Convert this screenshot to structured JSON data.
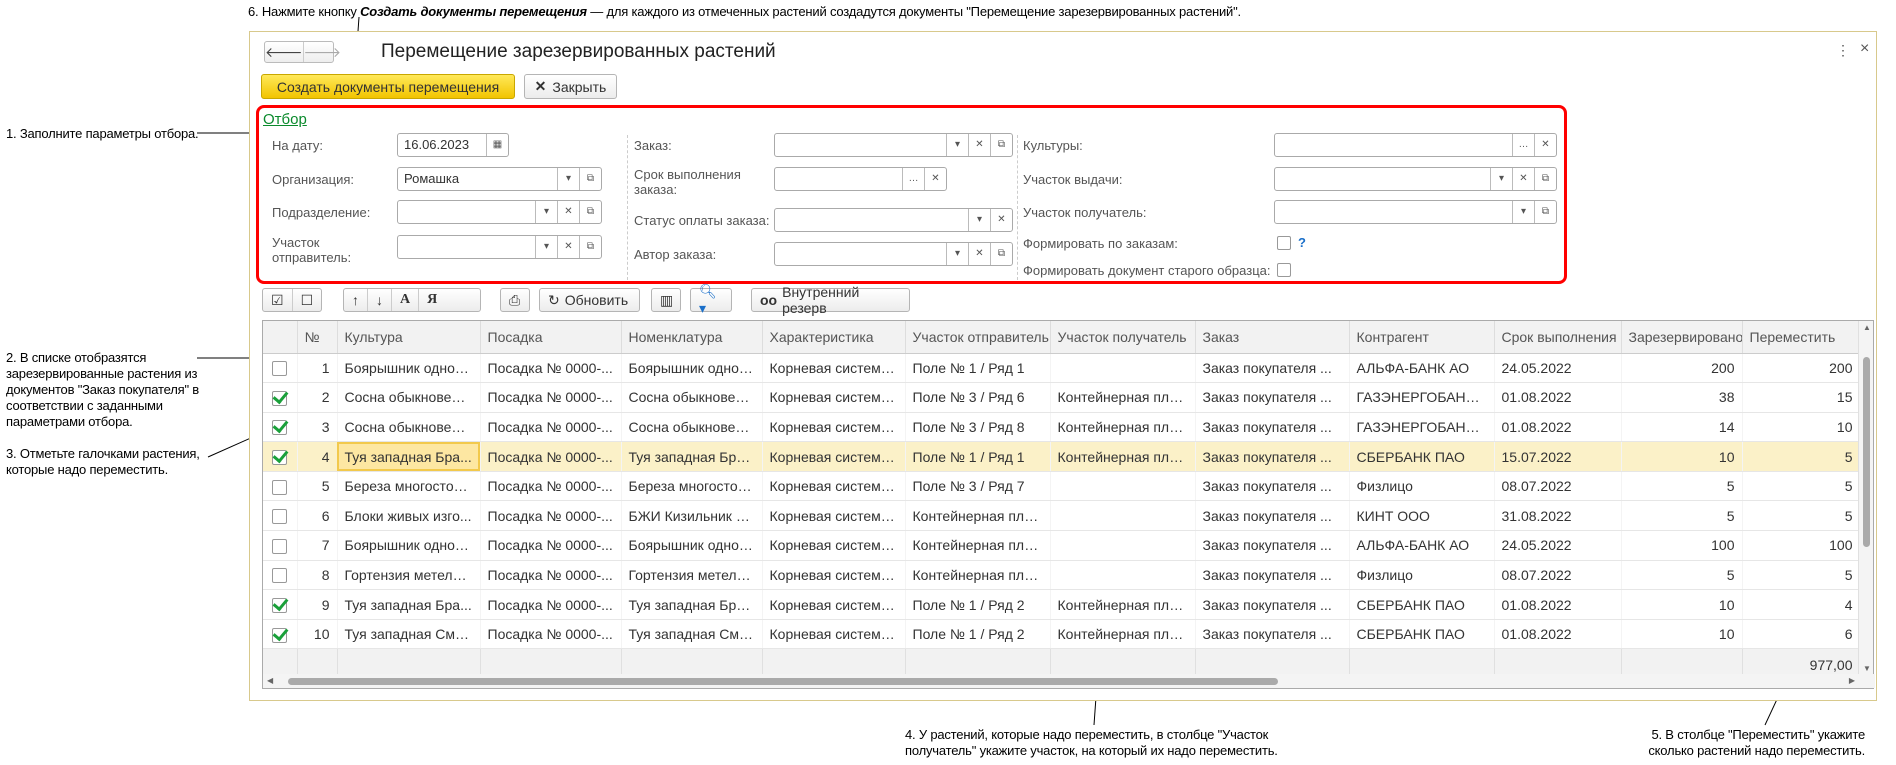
{
  "annotations": {
    "step6_prefix": "6. Нажмите кнопку ",
    "step6_bold": "Создать документы перемещения",
    "step6_suffix": " — для каждого из отмеченных растений создадутся документы \"Перемещение зарезервированных растений\".",
    "step1": "1. Заполните параметры отбора.",
    "step2": "2. В списке отобразятся зарезервированные растения из документов \"Заказ покупателя\" в соответствии с заданными параметрами отбора.",
    "step3": "3. Отметьте галочками растения, которые надо переместить.",
    "step4": "4. У растений, которые надо переместить, в столбце \"Участок получатель\" укажите участок, на который их надо переместить.",
    "step5": "5. В столбце \"Переместить\" укажите сколько растений надо переместить."
  },
  "window": {
    "title": "Перемещение зарезервированных растений",
    "create_label": "Создать документы перемещения",
    "close_label": "Закрыть"
  },
  "filter": {
    "title": "Отбор",
    "date_label": "На дату:",
    "date_value": "16.06.2023",
    "org_label": "Организация:",
    "org_value": "Ромашка",
    "dept_label": "Подразделение:",
    "sender_label": "Участок отправитель:",
    "order_label": "Заказ:",
    "deadline_label": "Срок выполнения заказа:",
    "paystatus_label": "Статус оплаты заказа:",
    "author_label": "Автор заказа:",
    "cultures_label": "Культуры:",
    "issue_label": "Участок выдачи:",
    "receiver_label": "Участок получатель:",
    "by_orders_label": "Формировать по заказам:",
    "old_doc_label": "Формировать документ старого образца:",
    "help": "?"
  },
  "toolbar": {
    "refresh_label": "Обновить",
    "reserve_label": "Внутренний резерв",
    "sort_a": "А",
    "sort_ya": "Я"
  },
  "table": {
    "columns": [
      "",
      "№",
      "Культура",
      "Посадка",
      "Номенклатура",
      "Характеристика",
      "Участок отправитель",
      "Участок получатель",
      "Заказ",
      "Контрагент",
      "Срок выполнения",
      "Зарезервировано",
      "Переместить"
    ],
    "rows": [
      {
        "checked": false,
        "n": "1",
        "culture": "Боярышник одноп...",
        "planting": "Посадка № 0000-...",
        "nom": "Боярышник одноп...",
        "char": "Корневая система...",
        "from": "Поле № 1 / Ряд 1",
        "to": "",
        "order": "Заказ покупателя ...",
        "agent": "АЛЬФА-БАНК АО",
        "date": "24.05.2022",
        "reserved": "200",
        "move": "200"
      },
      {
        "checked": true,
        "n": "2",
        "culture": "Сосна обыкновенная",
        "planting": "Посадка № 0000-...",
        "nom": "Сосна обыкновенн...",
        "char": "Корневая система...",
        "from": "Поле № 3 / Ряд 6",
        "to": "Контейнерная пло...",
        "order": "Заказ покупателя ...",
        "agent": "ГАЗЭНЕРГОБАНК ...",
        "date": "01.08.2022",
        "reserved": "38",
        "move": "15"
      },
      {
        "checked": true,
        "n": "3",
        "culture": "Сосна обыкновенная",
        "planting": "Посадка № 0000-...",
        "nom": "Сосна обыкновенн...",
        "char": "Корневая система...",
        "from": "Поле № 3 / Ряд 8",
        "to": "Контейнерная пло...",
        "order": "Заказ покупателя ...",
        "agent": "ГАЗЭНЕРГОБАНК ...",
        "date": "01.08.2022",
        "reserved": "14",
        "move": "10"
      },
      {
        "checked": true,
        "n": "4",
        "culture": "Туя западная Бра...",
        "planting": "Посадка № 0000-...",
        "nom": "Туя западная Бра...",
        "char": "Корневая система...",
        "from": "Поле № 1 / Ряд 1",
        "to": "Контейнерная пло...",
        "order": "Заказ покупателя ...",
        "agent": "СБЕРБАНК ПАО",
        "date": "15.07.2022",
        "reserved": "10",
        "move": "5",
        "selected": true
      },
      {
        "checked": false,
        "n": "5",
        "culture": "Береза многостово...",
        "planting": "Посадка № 0000-...",
        "nom": "Береза многостово...",
        "char": "Корневая система...",
        "from": "Поле № 3 / Ряд 7",
        "to": "",
        "order": "Заказ покупателя ...",
        "agent": "Физлицо",
        "date": "08.07.2022",
        "reserved": "5",
        "move": "5"
      },
      {
        "checked": false,
        "n": "6",
        "culture": "Блоки живых изго...",
        "planting": "Посадка № 0000-...",
        "nom": "БЖИ Кизильник бл...",
        "char": "Корневая система...",
        "from": "Контейнерная пло...",
        "to": "",
        "order": "Заказ покупателя ...",
        "agent": "КИНТ ООО",
        "date": "31.08.2022",
        "reserved": "5",
        "move": "5"
      },
      {
        "checked": false,
        "n": "7",
        "culture": "Боярышник одноп...",
        "planting": "Посадка № 0000-...",
        "nom": "Боярышник одноп...",
        "char": "Корневая система...",
        "from": "Контейнерная пло...",
        "to": "",
        "order": "Заказ покупателя ...",
        "agent": "АЛЬФА-БАНК АО",
        "date": "24.05.2022",
        "reserved": "100",
        "move": "100"
      },
      {
        "checked": false,
        "n": "8",
        "culture": "Гортензия метельч...",
        "planting": "Посадка № 0000-...",
        "nom": "Гортензия метельч...",
        "char": "Корневая система...",
        "from": "Контейнерная пло...",
        "to": "",
        "order": "Заказ покупателя ...",
        "agent": "Физлицо",
        "date": "08.07.2022",
        "reserved": "5",
        "move": "5"
      },
      {
        "checked": true,
        "n": "9",
        "culture": "Туя западная Бра...",
        "planting": "Посадка № 0000-...",
        "nom": "Туя западная Бра...",
        "char": "Корневая система...",
        "from": "Поле № 1 / Ряд 2",
        "to": "Контейнерная пло...",
        "order": "Заказ покупателя ...",
        "agent": "СБЕРБАНК ПАО",
        "date": "01.08.2022",
        "reserved": "10",
        "move": "4"
      },
      {
        "checked": true,
        "n": "10",
        "culture": "Туя западная Сма...",
        "planting": "Посадка № 0000-...",
        "nom": "Туя западная Сма...",
        "char": "Корневая система...",
        "from": "Поле № 1 / Ряд 2",
        "to": "Контейнерная пло...",
        "order": "Заказ покупателя ...",
        "agent": "СБЕРБАНК ПАО",
        "date": "01.08.2022",
        "reserved": "10",
        "move": "6"
      }
    ],
    "total_move": "977,00"
  }
}
